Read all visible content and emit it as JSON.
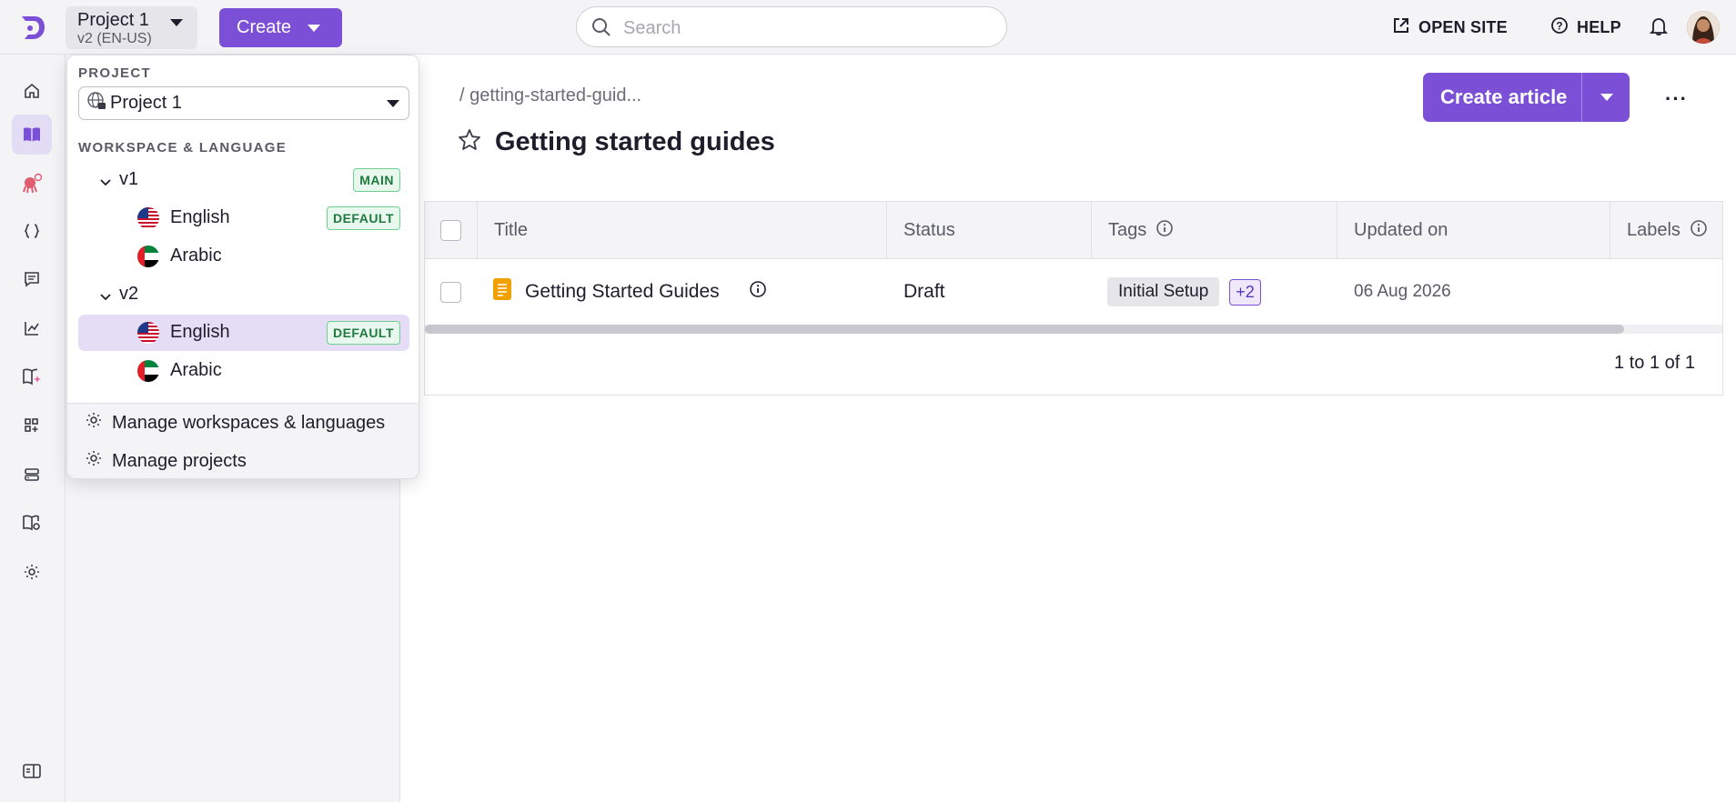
{
  "topbar": {
    "project_name": "Project 1",
    "project_sub": "v2 (EN-US)",
    "create_label": "Create",
    "search_placeholder": "Search",
    "open_site_label": "OPEN SITE",
    "help_label": "HELP"
  },
  "popover": {
    "project_heading": "PROJECT",
    "project_value": "Project 1",
    "workspace_heading": "WORKSPACE & LANGUAGE",
    "workspaces": [
      {
        "name": "v1",
        "badge": "MAIN",
        "languages": [
          {
            "name": "English",
            "badge": "DEFAULT",
            "flag": "us-flag"
          },
          {
            "name": "Arabic",
            "badge": "",
            "flag": "uae-flag"
          }
        ]
      },
      {
        "name": "v2",
        "badge": "",
        "languages": [
          {
            "name": "English",
            "badge": "DEFAULT",
            "flag": "us-flag",
            "selected": true
          },
          {
            "name": "Arabic",
            "badge": "",
            "flag": "uae-flag"
          }
        ]
      }
    ],
    "manage_workspaces_label": "Manage workspaces & languages",
    "manage_projects_label": "Manage projects"
  },
  "main": {
    "breadcrumb": "/ getting-started-guid...",
    "title": "Getting started guides",
    "create_article_label": "Create article",
    "more_label": "···",
    "table": {
      "columns": [
        "Title",
        "Status",
        "Tags",
        "Updated on",
        "Labels"
      ],
      "rows": [
        {
          "title": "Getting Started Guides",
          "status": "Draft",
          "tag": "Initial Setup",
          "tag_more": "+2",
          "updated": "06 Aug 2026",
          "labels": ""
        }
      ],
      "pagination": "1 to 1 of 1"
    }
  },
  "colors": {
    "accent": "#7b4fd6",
    "badge_green": "#1e7a3e",
    "draft_icon": "#f2a000"
  }
}
